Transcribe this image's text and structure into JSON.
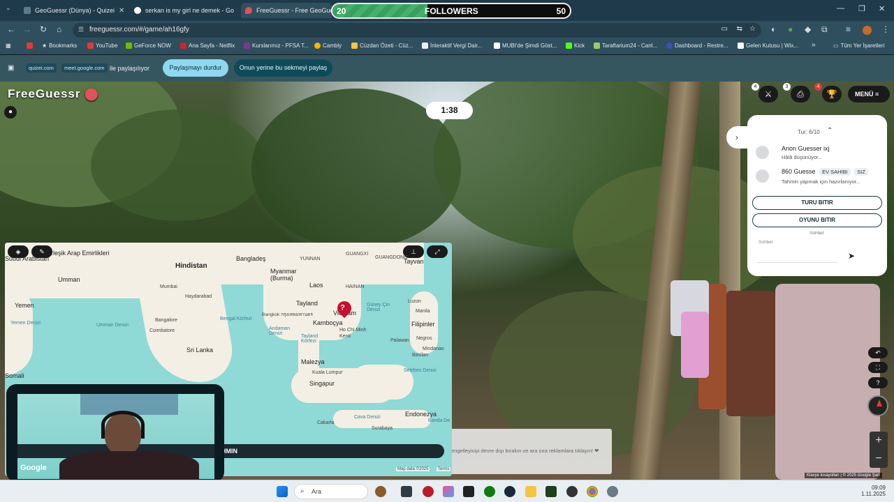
{
  "tabs": [
    {
      "title": "GeoGuessr (Dünya) - Quizei",
      "close": "✕"
    },
    {
      "title": "serkan is my girl ne demek - Go",
      "close": "✕"
    },
    {
      "title": "FreeGuessr - Free GeoGues",
      "close": "✕"
    }
  ],
  "followers_bar": {
    "current": "20",
    "label": "FOLLOWERS",
    "goal": "50",
    "progress": 0.4
  },
  "address": {
    "url": "freeguessr.com/#/game/ah16gfy"
  },
  "bookmarks": [
    "Bookmarks",
    "YouTube",
    "GeForce NOW",
    "Ana Sayfa - Netflix",
    "Kurslarımız - PFSA T...",
    "Cambly",
    "Cüzdan Özeti - Cüz...",
    "İnteraktif Vergi Dair...",
    "MUBI'de Şimdi Göst...",
    "Kick",
    "Taraftarium24 - Canl...",
    "Dashboard - Restre...",
    "Gelen Kutusu | Wix..."
  ],
  "bookmarks_more": "»",
  "all_bookmarks": "Tüm Yer İşaretleri",
  "share": {
    "chip1": "quizei.com",
    "chip2": "meet.google.com",
    "text": "ile paylaşılıyor",
    "stop": "Paylaşmayı durdur",
    "share_this": "Onun yerine bu sekmeyi paylaş"
  },
  "game": {
    "logo": "FreeGuessr",
    "timer": "1:38",
    "menu": "MENÜ",
    "badges": {
      "battle": "4",
      "print": "3",
      "trophy": "4"
    },
    "panel": {
      "round": "Tur: 6/10",
      "players": [
        {
          "name": "Anon Guesser ixj",
          "status": "Hâlâ düşünüyor...",
          "tags": []
        },
        {
          "name": "860 Guesse",
          "status": "Tahmin yapmak için hazırlanıyor...",
          "tags": [
            "EV SAHIBI",
            "SIZ"
          ]
        }
      ],
      "end_round": "TURU BITIR",
      "end_game": "OYUNU BITIR",
      "chat_header": "Sohbet",
      "chat_placeholder": "Sohbet"
    },
    "guess_label": "HMIN",
    "ad_text": "engelleyiciyi devre dışı bırakın ve ara sıra reklamlara tıklayın! ❤",
    "map_attrib": {
      "data": "Map data ©2025",
      "terms": "Terms"
    },
    "footer": {
      "shortcuts": "Klavye kısayolları",
      "copy": "© 2025 Google",
      "corner": "Şart"
    },
    "map_labels": {
      "countries": [
        "Hindistan",
        "Bangladeş",
        "Myanmar (Burma)",
        "Laos",
        "Tayland",
        "Kamboçya",
        "Vietnam",
        "Tayvan",
        "Filipinler",
        "Malezya",
        "Singapur",
        "Endonezya",
        "Sri Lanka",
        "Umman",
        "Yemen",
        "Suudi Arabistan",
        "Birleşik Arap Emirlikleri",
        "Somali"
      ],
      "cities": [
        "Mumbai",
        "Haydarabad",
        "Bangalore",
        "Coimbatore",
        "Bangkok กรุงเทพมหานคร",
        "Ho Chi Minh Kenti",
        "Manila",
        "Luzon",
        "Kuala Lumpur",
        "Cakarta",
        "Surabaya",
        "Palawan",
        "Negros",
        "Mindanao",
        "Basilan"
      ],
      "seas": [
        "Bengal Körfezi",
        "Andaman Denizi",
        "Tayland Körfezi",
        "Güney Çin Denizi",
        "Umman Denizi",
        "Yemen Denizi",
        "Selebes Denizi",
        "Cava Denizi",
        "Banda De"
      ],
      "regions": [
        "GUANGXI",
        "GUANGDONG",
        "YUNNAN",
        "HAINAN"
      ],
      "google": "Google"
    }
  },
  "taskbar": {
    "search": "Ara",
    "time": "09:09",
    "date": "1.11.2025"
  },
  "colors": {
    "tab_strip": "#1f3a4a",
    "toolbar": "#2f4f5f",
    "share_bar": "#36565f",
    "stop_pill": "#8fd8ef",
    "share_pill": "#0f4a58",
    "map_water": "#8fd9d6",
    "map_land": "#f3efe4",
    "pin": "#c8102e"
  }
}
